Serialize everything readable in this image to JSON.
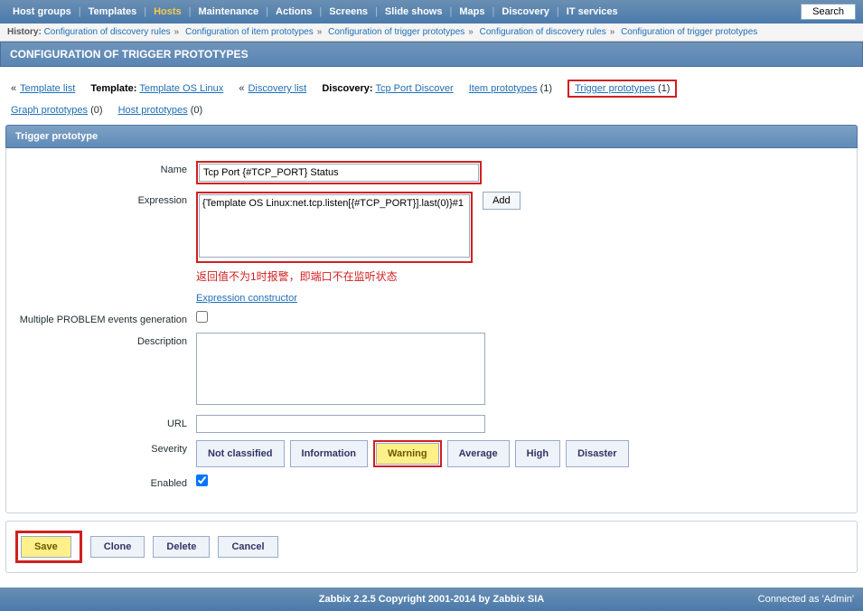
{
  "topnav": {
    "items": [
      "Host groups",
      "Templates",
      "Hosts",
      "Maintenance",
      "Actions",
      "Screens",
      "Slide shows",
      "Maps",
      "Discovery",
      "IT services"
    ],
    "active_index": 2,
    "search": "Search"
  },
  "history": {
    "label": "History:",
    "items": [
      "Configuration of discovery rules",
      "Configuration of item prototypes",
      "Configuration of trigger prototypes",
      "Configuration of discovery rules",
      "Configuration of trigger prototypes"
    ]
  },
  "page_title": "CONFIGURATION OF TRIGGER PROTOTYPES",
  "crumb": {
    "template_list": "Template list",
    "template_lbl": "Template:",
    "template_name": "Template OS Linux",
    "discovery_list": "Discovery list",
    "discovery_lbl": "Discovery:",
    "discovery_name": "Tcp Port Discover",
    "item_proto": "Item prototypes",
    "item_count": "(1)",
    "trig_proto": "Trigger prototypes",
    "trig_count": "(1)",
    "graph_proto": "Graph prototypes",
    "graph_count": "(0)",
    "host_proto": "Host prototypes",
    "host_count": "(0)"
  },
  "section": "Trigger prototype",
  "form": {
    "name_lbl": "Name",
    "name_val": "Tcp Port {#TCP_PORT} Status",
    "expr_lbl": "Expression",
    "expr_val": "{Template OS Linux:net.tcp.listen[{#TCP_PORT}].last(0)}#1",
    "add": "Add",
    "annotation": "返回值不为1时报警，即端口不在监听状态",
    "expr_constructor": "Expression constructor",
    "multi_lbl": "Multiple PROBLEM events generation",
    "desc_lbl": "Description",
    "url_lbl": "URL",
    "sev_lbl": "Severity",
    "sev": [
      "Not classified",
      "Information",
      "Warning",
      "Average",
      "High",
      "Disaster"
    ],
    "enabled_lbl": "Enabled"
  },
  "buttons": {
    "save": "Save",
    "clone": "Clone",
    "delete": "Delete",
    "cancel": "Cancel"
  },
  "footer": {
    "text": "Zabbix 2.2.5 Copyright 2001-2014 by Zabbix SIA",
    "right": "Connected as 'Admin'"
  }
}
